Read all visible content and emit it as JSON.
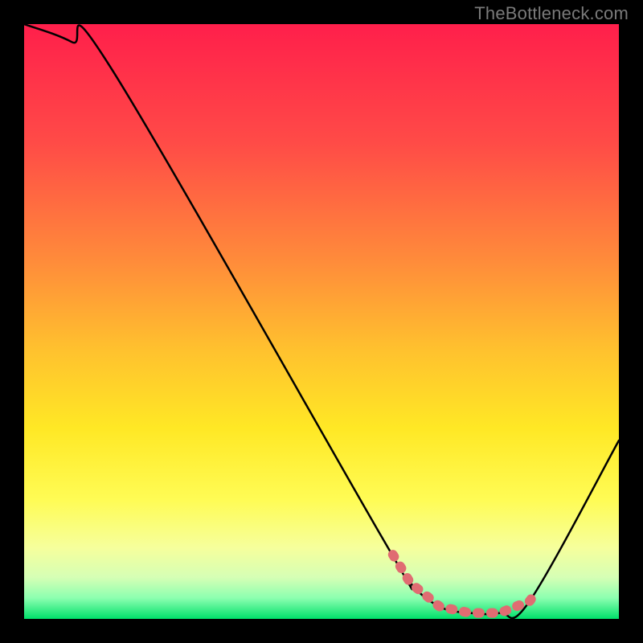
{
  "watermark": "TheBottleneck.com",
  "chart_data": {
    "type": "line",
    "title": "",
    "xlabel": "",
    "ylabel": "",
    "xlim": [
      0,
      100
    ],
    "ylim": [
      0,
      100
    ],
    "series": [
      {
        "name": "curve",
        "x": [
          0,
          8,
          15,
          60,
          65,
          70,
          75,
          80,
          85,
          100
        ],
        "y": [
          100,
          97,
          92,
          14,
          6,
          2,
          1,
          1,
          3,
          30
        ]
      }
    ],
    "highlight_range": {
      "x_start": 62,
      "x_end": 86
    },
    "gradient_stops": [
      {
        "pos": 0.0,
        "color": "#ff1f4b"
      },
      {
        "pos": 0.2,
        "color": "#ff4b47"
      },
      {
        "pos": 0.4,
        "color": "#ff8c3a"
      },
      {
        "pos": 0.55,
        "color": "#ffc22e"
      },
      {
        "pos": 0.68,
        "color": "#ffe825"
      },
      {
        "pos": 0.8,
        "color": "#fffc55"
      },
      {
        "pos": 0.88,
        "color": "#f6ff9c"
      },
      {
        "pos": 0.93,
        "color": "#d6ffb5"
      },
      {
        "pos": 0.965,
        "color": "#8cffb0"
      },
      {
        "pos": 1.0,
        "color": "#00e06a"
      }
    ]
  },
  "colors": {
    "curve_stroke": "#000000",
    "highlight_stroke": "#e06c72",
    "background": "#000000"
  }
}
